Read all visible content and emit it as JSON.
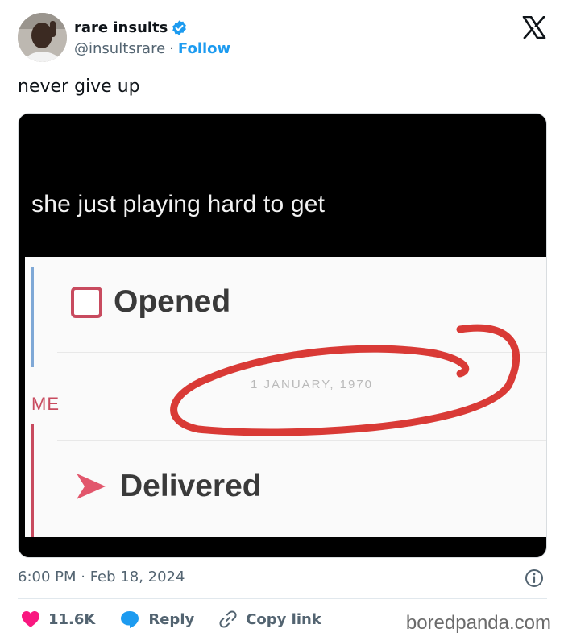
{
  "user": {
    "display_name": "rare insults",
    "handle": "@insultsrare",
    "separator": "·",
    "follow_label": "Follow"
  },
  "tweet": {
    "text": "never give up",
    "timestamp": "6:00 PM · Feb 18, 2024"
  },
  "media": {
    "caption": "she just playing hard to get",
    "opened_label": "Opened",
    "date_text": "1 JANUARY, 1970",
    "me_label": "ME",
    "delivered_label": "Delivered"
  },
  "actions": {
    "likes_count": "11.6K",
    "reply_label": "Reply",
    "copy_link_label": "Copy link"
  },
  "watermark": "boredpanda.com",
  "colors": {
    "accent": "#1d9bf0",
    "like": "#f91880",
    "muted": "#536471",
    "snap_red": "#c84b5f",
    "marker_red": "#d93a36"
  },
  "icons": [
    "verified-badge-icon",
    "x-logo-icon",
    "info-icon",
    "heart-icon",
    "reply-bubble-icon",
    "link-icon"
  ]
}
